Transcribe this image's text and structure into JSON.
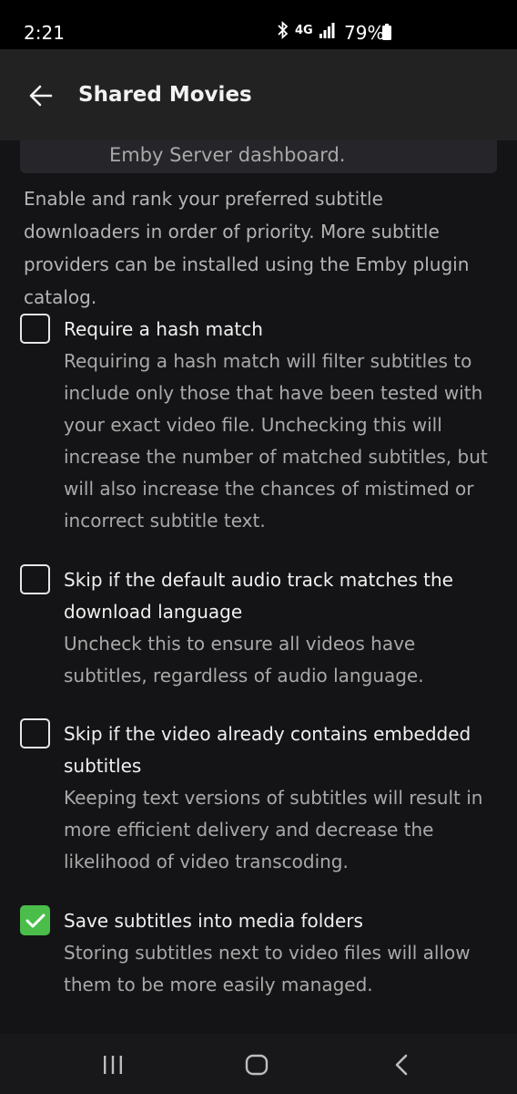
{
  "status_bar": {
    "time": "2:21",
    "network": "4G",
    "battery": "79%"
  },
  "app_bar": {
    "title": "Shared Movies"
  },
  "info_card": {
    "text": "Emby Server dashboard."
  },
  "intro_text": "Enable and rank your preferred subtitle downloaders in order of priority. More subtitle providers can be installed using the Emby plugin catalog.",
  "options": [
    {
      "label": "Require a hash match",
      "description": "Requiring a hash match will filter subtitles to include only those that have been tested with your exact video file. Unchecking this will increase the number of matched subtitles, but will also increase the chances of mistimed or incorrect subtitle text.",
      "checked": false
    },
    {
      "label": "Skip if the default audio track matches the download language",
      "description": "Uncheck this to ensure all videos have subtitles, regardless of audio language.",
      "checked": false
    },
    {
      "label": "Skip if the video already contains embedded subtitles",
      "description": "Keeping text versions of subtitles will result in more efficient delivery and decrease the likelihood of video transcoding.",
      "checked": false
    },
    {
      "label": "Save subtitles into media folders",
      "description": "Storing subtitles next to video files will allow them to be more easily managed.",
      "checked": true
    }
  ],
  "colors": {
    "accent": "#4bbd4b",
    "background": "#141416",
    "app_bar": "#222222"
  }
}
